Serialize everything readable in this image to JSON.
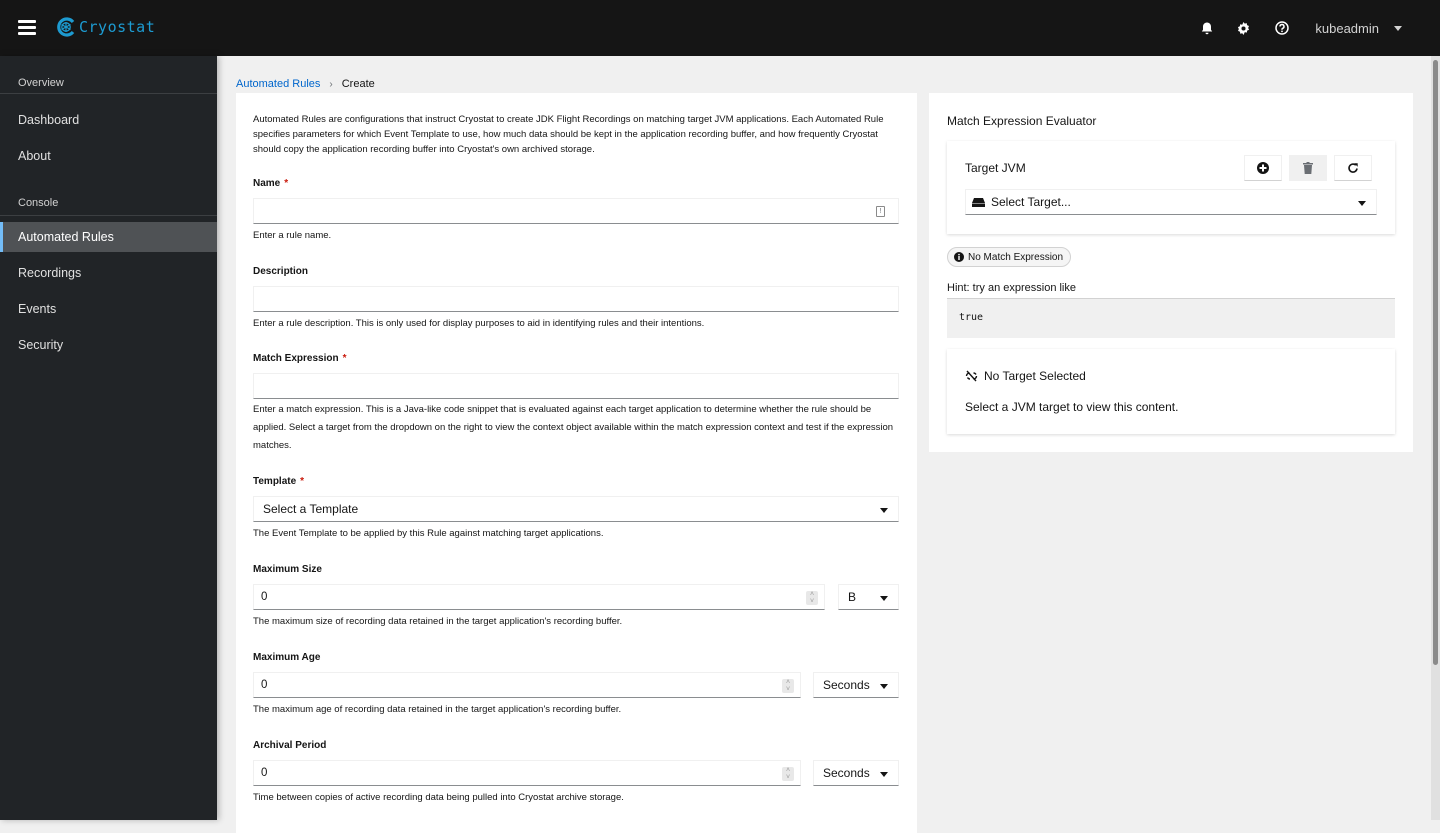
{
  "app": {
    "brand": "Cryostat",
    "brand_color": "#1d9bd1",
    "user": "kubeadmin",
    "header_icons": [
      "bell-icon",
      "gear-icon",
      "help-icon"
    ]
  },
  "sidebar": {
    "sections": [
      {
        "title": "Overview",
        "items": [
          {
            "label": "Dashboard"
          },
          {
            "label": "About"
          }
        ]
      },
      {
        "title": "Console",
        "items": [
          {
            "label": "Automated Rules",
            "active": true
          },
          {
            "label": "Recordings"
          },
          {
            "label": "Events"
          },
          {
            "label": "Security"
          }
        ]
      }
    ]
  },
  "breadcrumb": {
    "parent": "Automated Rules",
    "current": "Create"
  },
  "form": {
    "description": "Automated Rules are configurations that instruct Cryostat to create JDK Flight Recordings on matching target JVM applications. Each Automated Rule specifies parameters for which Event Template to use, how much data should be kept in the application recording buffer, and how frequently Cryostat should copy the application recording buffer into Cryostat's own archived storage.",
    "name": {
      "label": "Name",
      "required": "*",
      "value": "",
      "helper": "Enter a rule name."
    },
    "description_field": {
      "label": "Description",
      "value": "",
      "helper": "Enter a rule description. This is only used for display purposes to aid in identifying rules and their intentions."
    },
    "match_expression": {
      "label": "Match Expression",
      "required": "*",
      "value": "",
      "helper": "Enter a match expression. This is a Java-like code snippet that is evaluated against each target application to determine whether the rule should be applied. Select a target from the dropdown on the right to view the context object available within the match expression context and test if the expression matches."
    },
    "template": {
      "label": "Template",
      "required": "*",
      "selected": "Select a Template",
      "helper": "The Event Template to be applied by this Rule against matching target applications."
    },
    "max_size": {
      "label": "Maximum Size",
      "value": "0",
      "unit": "B",
      "helper": "The maximum size of recording data retained in the target application's recording buffer."
    },
    "max_age": {
      "label": "Maximum Age",
      "value": "0",
      "unit": "Seconds",
      "helper": "The maximum age of recording data retained in the target application's recording buffer."
    },
    "archival_period": {
      "label": "Archival Period",
      "value": "0",
      "unit": "Seconds",
      "helper": "Time between copies of active recording data being pulled into Cryostat archive storage."
    }
  },
  "evaluator": {
    "title": "Match Expression Evaluator",
    "target_label": "Target JVM",
    "target_placeholder": "Select Target...",
    "status_chip": "No Match Expression",
    "hint": "Hint: try an expression like",
    "hint_code": "true",
    "empty_title": "No Target Selected",
    "empty_body": "Select a JVM target to view this content."
  }
}
